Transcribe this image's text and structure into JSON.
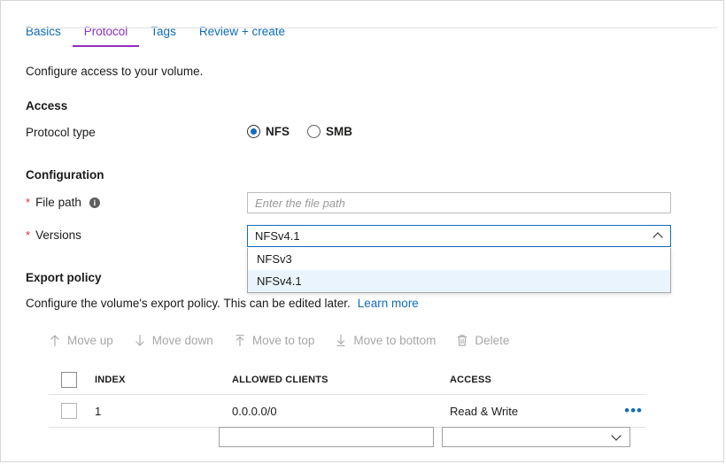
{
  "tabs": [
    {
      "label": "Basics",
      "active": false
    },
    {
      "label": "Protocol",
      "active": true
    },
    {
      "label": "Tags",
      "active": false
    },
    {
      "label": "Review + create",
      "active": false
    }
  ],
  "intro": "Configure access to your volume.",
  "access": {
    "heading": "Access",
    "protocol_type_label": "Protocol type",
    "options": [
      {
        "label": "NFS",
        "selected": true
      },
      {
        "label": "SMB",
        "selected": false
      }
    ]
  },
  "configuration": {
    "heading": "Configuration",
    "file_path": {
      "label": "File path",
      "required_marker": "*",
      "info_icon": "info-icon",
      "value": "",
      "placeholder": "Enter the file path"
    },
    "versions": {
      "label": "Versions",
      "required_marker": "*",
      "selected": "NFSv4.1",
      "expanded": true,
      "chevron": "chevron-up-icon",
      "options": [
        {
          "label": "NFSv3",
          "selected": false
        },
        {
          "label": "NFSv4.1",
          "selected": true
        }
      ]
    }
  },
  "export_policy": {
    "heading": "Export policy",
    "description": "Configure the volume's export policy. This can be edited later.",
    "learn_more": "Learn more",
    "commands": [
      {
        "label": "Move up",
        "icon": "arrow-up-icon",
        "enabled": false
      },
      {
        "label": "Move down",
        "icon": "arrow-down-icon",
        "enabled": false
      },
      {
        "label": "Move to top",
        "icon": "arrow-to-top-icon",
        "enabled": false
      },
      {
        "label": "Move to bottom",
        "icon": "arrow-to-bottom-icon",
        "enabled": false
      },
      {
        "label": "Delete",
        "icon": "trash-icon",
        "enabled": false
      }
    ],
    "table": {
      "columns": [
        "INDEX",
        "ALLOWED CLIENTS",
        "ACCESS"
      ],
      "rows": [
        {
          "index": "1",
          "allowed_clients": "0.0.0.0/0",
          "access": "Read & Write",
          "menu": "•••"
        }
      ]
    },
    "new_entry": {
      "client_value": "",
      "client_placeholder": "",
      "access_value": "",
      "chevron": "chevron-down-icon"
    }
  },
  "colors": {
    "accent_blue": "#0f6cbd",
    "tab_active_purple": "#8f2fbf",
    "required_red": "#d13438",
    "option_highlight": "#e9f4fc",
    "border_gray": "#e1e1e1"
  }
}
